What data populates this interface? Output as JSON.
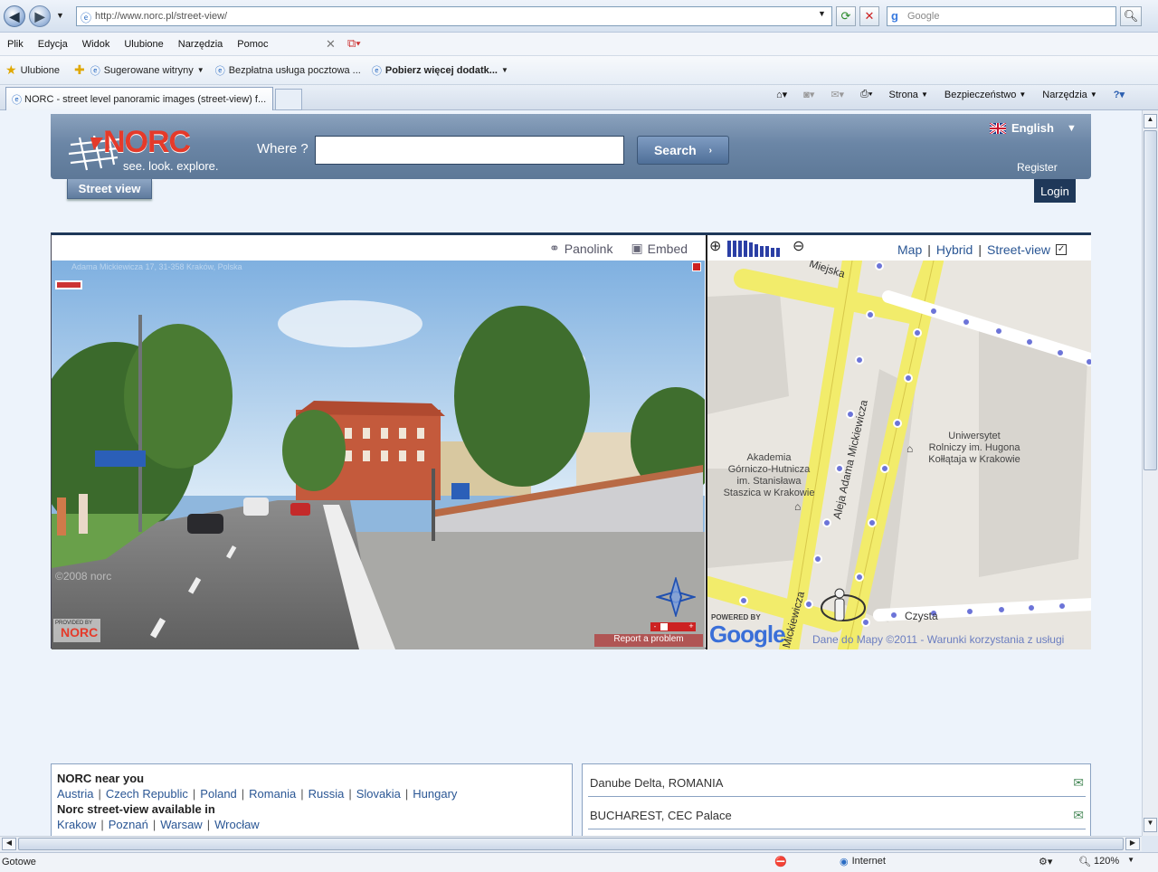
{
  "browser": {
    "url": "http://www.norc.pl/street-view/",
    "search_placeholder": "Google",
    "menu": [
      "Plik",
      "Edycja",
      "Widok",
      "Ulubione",
      "Narzędzia",
      "Pomoc"
    ],
    "favorites_label": "Ulubione",
    "favorites": [
      "Sugerowane witryny",
      "Bezpłatna usługa pocztowa ...",
      "Pobierz więcej dodatk..."
    ],
    "tab_title": "NORC - street level panoramic images (street-view) f...",
    "commands": [
      "Strona",
      "Bezpieczeństwo",
      "Narzędzia"
    ],
    "status_text": "Gotowe",
    "zone": "Internet",
    "zoom": "120%"
  },
  "header": {
    "logo_word": "NORC",
    "tagline": "see. look. explore.",
    "where_label": "Where ?",
    "search_button": "Search",
    "language": "English",
    "register": "Register",
    "nav_tab": "Street view",
    "login": "Login"
  },
  "viewer": {
    "panolink": "Panolink",
    "embed": "Embed",
    "address_overlay": "Adama Mickiewicza 17, 31-358 Kraków, Polska",
    "watermark": "©2008 norc",
    "provided_by": "PROVIDED BY",
    "provided_brand": "NORC",
    "report": "Report a problem"
  },
  "map": {
    "types": [
      "Map",
      "Hybrid",
      "Street-view"
    ],
    "street_view_checked": true,
    "labels": {
      "street_main": "Aleja Adama Mickiewicza",
      "street_top": "Miejska",
      "street_bottom": "Mickiewicza",
      "street_czysta": "Czysta",
      "akademia": "Akademia\nGórniczo-Hutnicza\nim. Stanisława\nStaszica w Krakowie",
      "uniwersytet": "Uniwersytet\nRolniczy im. Hugona\nKołłątaja w Krakowie"
    },
    "powered_by": "POWERED BY",
    "google": "Google",
    "copyright": "Dane do Mapy ©2011",
    "terms": "Warunki korzystania z usługi"
  },
  "footer": {
    "near_title": "NORC near you",
    "countries": [
      "Austria",
      "Czech Republic",
      "Poland",
      "Romania",
      "Russia",
      "Slovakia",
      "Hungary"
    ],
    "available_title": "Norc street-view available in",
    "cities": [
      "Krakow",
      "Poznań",
      "Warsaw",
      "Wrocław"
    ],
    "news": [
      "Danube Delta, ROMANIA",
      "BUCHAREST, CEC Palace"
    ]
  }
}
